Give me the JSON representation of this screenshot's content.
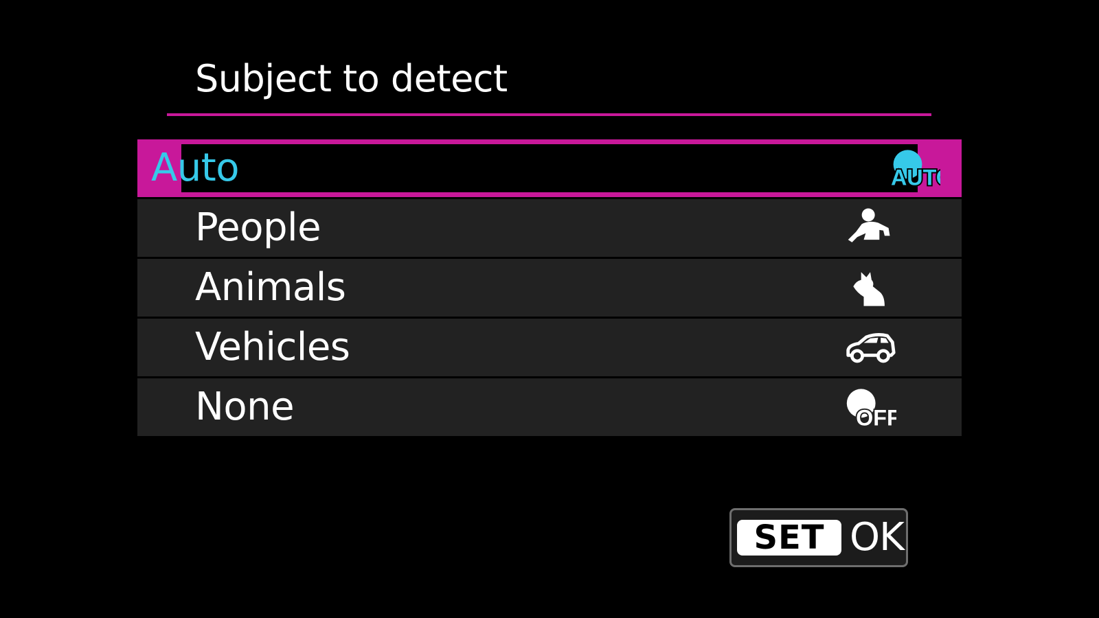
{
  "title": "Subject to detect",
  "colors": {
    "accent": "#c8189a",
    "selected_text": "#36c9e9",
    "row_bg": "#222222"
  },
  "options": [
    {
      "label": "Auto",
      "icon": "auto-detect-icon",
      "icon_text": "AUTO",
      "selected": true
    },
    {
      "label": "People",
      "icon": "person-icon",
      "selected": false
    },
    {
      "label": "Animals",
      "icon": "animal-icon",
      "selected": false
    },
    {
      "label": "Vehicles",
      "icon": "car-icon",
      "selected": false
    },
    {
      "label": "None",
      "icon": "detect-off-icon",
      "icon_text": "OFF",
      "selected": false
    }
  ],
  "footer": {
    "set_key": "SET",
    "ok_label": "OK"
  }
}
